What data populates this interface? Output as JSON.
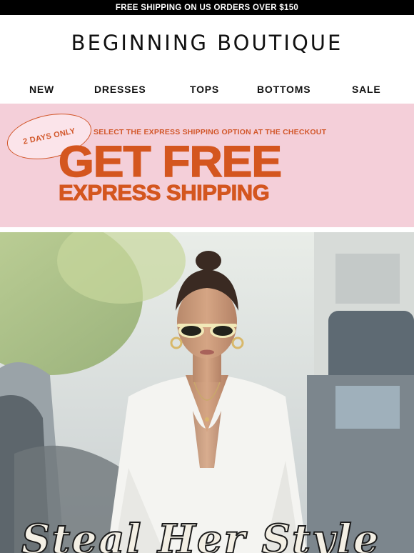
{
  "topbar": {
    "text": "FREE SHIPPING ON US ORDERS OVER $150"
  },
  "brand": {
    "logo_text": "BEGINNING BOUTIQUE"
  },
  "nav": {
    "items": [
      {
        "label": "NEW"
      },
      {
        "label": "DRESSES"
      },
      {
        "label": "TOPS"
      },
      {
        "label": "BOTTOMS"
      },
      {
        "label": "SALE"
      }
    ]
  },
  "promo": {
    "badge": "2 DAYS ONLY",
    "subline": "SELECT THE EXPRESS SHIPPING OPTION AT THE CHECKOUT",
    "headline_line1": "GET FREE",
    "headline_line2": "EXPRESS SHIPPING",
    "background_color": "#f4cfd9",
    "accent_color": "#d4561f"
  },
  "hero": {
    "title": "Steal Her Style"
  }
}
